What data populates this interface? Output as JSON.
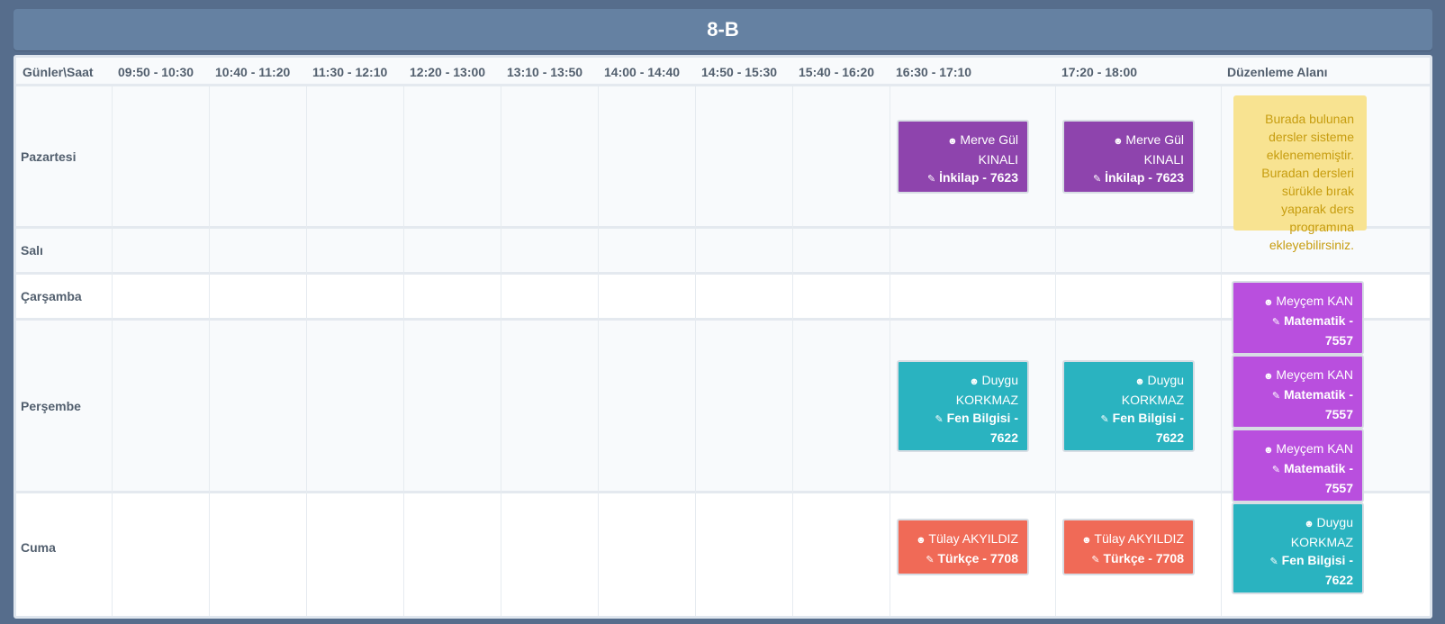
{
  "title": "8-B",
  "header": {
    "corner": "Günler\\Saat",
    "slots": [
      "09:50 - 10:30",
      "10:40 - 11:20",
      "11:30 - 12:10",
      "12:20 - 13:00",
      "13:10 - 13:50",
      "14:00 - 14:40",
      "14:50 - 15:30",
      "15:40 - 16:20",
      "16:30 - 17:10",
      "17:20 - 18:00"
    ],
    "edit_area": "Düzenleme Alanı"
  },
  "days": [
    "Pazartesi",
    "Salı",
    "Çarşamba",
    "Perşembe",
    "Cuma"
  ],
  "note": "Burada bulunan dersler sisteme eklenememiştir. Buradan dersleri sürükle bırak yaparak ders programına ekleyebilirsiniz.",
  "lessons": {
    "mon1": {
      "teacher": "Merve Gül KINALI",
      "course": "İnkilap - 7623"
    },
    "mon2": {
      "teacher": "Merve Gül KINALI",
      "course": "İnkilap - 7623"
    },
    "thu1": {
      "teacher": "Duygu KORKMAZ",
      "course": "Fen Bilgisi - 7622"
    },
    "thu2": {
      "teacher": "Duygu KORKMAZ",
      "course": "Fen Bilgisi - 7622"
    },
    "fri1": {
      "teacher": "Tülay AKYILDIZ",
      "course": "Türkçe - 7708"
    },
    "fri2": {
      "teacher": "Tülay AKYILDIZ",
      "course": "Türkçe - 7708"
    }
  },
  "pending": [
    {
      "teacher": "Meyçem KAN",
      "course": "Matematik - 7557"
    },
    {
      "teacher": "Meyçem KAN",
      "course": "Matematik - 7557"
    },
    {
      "teacher": "Meyçem KAN",
      "course": "Matematik - 7557"
    },
    {
      "teacher": "Duygu KORKMAZ",
      "course": "Fen Bilgisi - 7622"
    }
  ],
  "icons": {
    "teacher": "user-icon",
    "course": "edit-icon"
  },
  "colors": {
    "purple": "#8e44ad",
    "magenta": "#b94fde",
    "teal": "#2ab3c0",
    "red": "#f06a57",
    "note": "#f8e391"
  }
}
